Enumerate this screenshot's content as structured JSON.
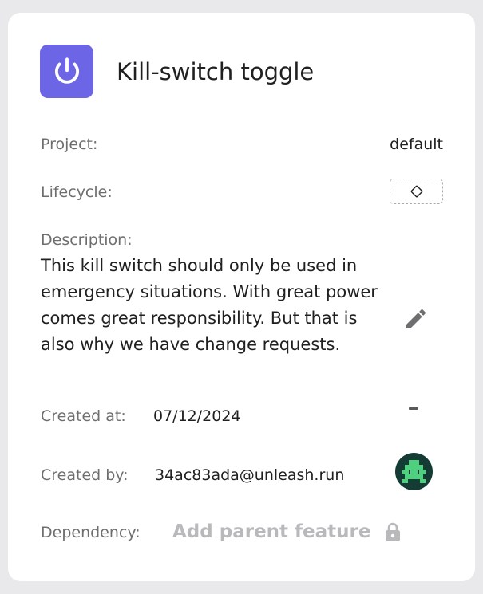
{
  "feature": {
    "title": "Kill-switch toggle",
    "icon": "power-icon",
    "accent_color": "#6c65e5"
  },
  "details": {
    "project_label": "Project:",
    "project_value": "default",
    "lifecycle_label": "Lifecycle:",
    "lifecycle_icon": "diamond-icon",
    "description_label": "Description:",
    "description_text": "This kill switch should only be used in emergency situations. With great power comes great responsibility. But that is also why we have change requests.",
    "created_at_label": "Created at:",
    "created_at_value": "07/12/2024",
    "created_by_label": "Created by:",
    "created_by_value": "34ac83ada@unleash.run",
    "dependency_label": "Dependency:",
    "add_parent_label": "Add parent feature"
  }
}
